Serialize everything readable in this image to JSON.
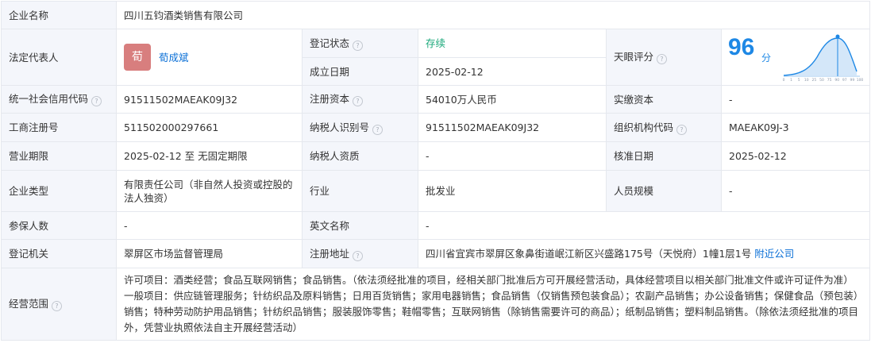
{
  "company_name": {
    "label": "企业名称",
    "value": "四川五钧酒类销售有限公司"
  },
  "legal_rep": {
    "label": "法定代表人",
    "avatar_char": "荀",
    "name": "荀成斌",
    "avatar_color": "#d87e7e"
  },
  "reg_status": {
    "label": "登记状态",
    "value": "存续",
    "color": "#1aa87a"
  },
  "established": {
    "label": "成立日期",
    "value": "2025-02-12"
  },
  "tianyan": {
    "label": "天眼评分",
    "score": "96",
    "unit": "分",
    "ticks": [
      "0",
      "1",
      "5",
      "10",
      "25",
      "50",
      "75",
      "90",
      "97",
      "99",
      "100"
    ],
    "score_percentile": 97
  },
  "credit_code": {
    "label": "统一社会信用代码",
    "value": "91511502MAEAK09J32"
  },
  "reg_capital": {
    "label": "注册资本",
    "value": "54010万人民币"
  },
  "paid_capital": {
    "label": "实缴资本",
    "value": "-"
  },
  "biz_reg_no": {
    "label": "工商注册号",
    "value": "511502000297661"
  },
  "taxpayer_id": {
    "label": "纳税人识别号",
    "value": "91511502MAEAK09J32"
  },
  "org_code": {
    "label": "组织机构代码",
    "value": "MAEAK09J-3"
  },
  "term": {
    "label": "营业期限",
    "value": "2025-02-12 至 无固定期限"
  },
  "taxpayer_qual": {
    "label": "纳税人资质",
    "value": "-"
  },
  "approval_date": {
    "label": "核准日期",
    "value": "2025-02-12"
  },
  "company_type": {
    "label": "企业类型",
    "value": "有限责任公司（非自然人投资或控股的法人独资）"
  },
  "industry": {
    "label": "行业",
    "value": "批发业"
  },
  "staff_size": {
    "label": "人员规模",
    "value": "-"
  },
  "insured": {
    "label": "参保人数",
    "value": "-"
  },
  "english_name": {
    "label": "英文名称",
    "value": "-"
  },
  "reg_authority": {
    "label": "登记机关",
    "value": "翠屏区市场监督管理局"
  },
  "reg_address": {
    "label": "注册地址",
    "value": "四川省宜宾市翠屏区象鼻街道岷江新区兴盛路175号（天悦府）1幢1层1号",
    "link": "附近公司"
  },
  "scope": {
    "label": "经营范围",
    "value": "许可项目：酒类经营；食品互联网销售；食品销售。（依法须经批准的项目，经相关部门批准后方可开展经营活动，具体经营项目以相关部门批准文件或许可证件为准）一般项目：供应链管理服务；针纺织品及原料销售；日用百货销售；家用电器销售；食品销售（仅销售预包装食品）；农副产品销售；办公设备销售；保健食品（预包装）销售；特种劳动防护用品销售；针纺织品销售；服装服饰零售；鞋帽零售；互联网销售（除销售需要许可的商品）；纸制品销售；塑料制品销售。（除依法须经批准的项目外，凭营业执照依法自主开展经营活动）"
  },
  "help_icon_glyph": "?",
  "colors": {
    "label_bg": "#f4f6fb",
    "border": "#e5e8ee",
    "link": "#0a6fd6",
    "score": "#1e88e5"
  }
}
